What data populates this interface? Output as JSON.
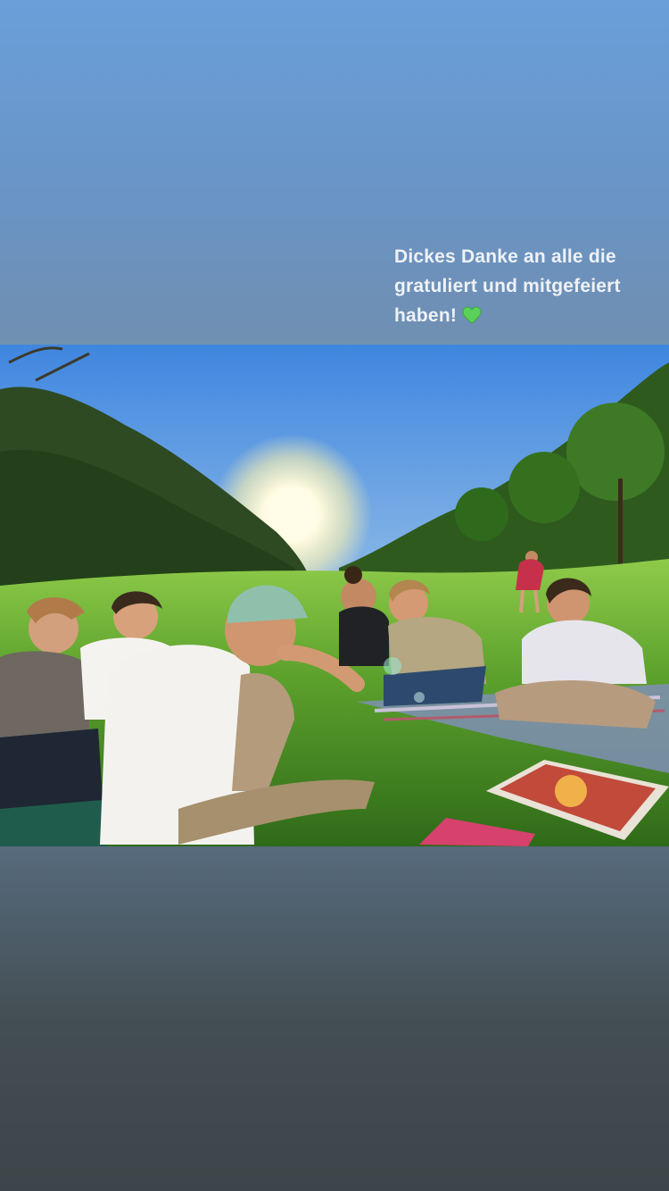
{
  "story": {
    "caption": "Dickes Danke an alle die gratuliert und mitgefeiert haben!",
    "caption_emoji": "green-heart-icon",
    "colors": {
      "bg_top": "#6a9fd9",
      "bg_bottom": "#3d4549",
      "caption_text": "#eef2f7",
      "heart": "#5bd15a"
    }
  },
  "photo": {
    "description_icon": "group-picnic-photo"
  }
}
